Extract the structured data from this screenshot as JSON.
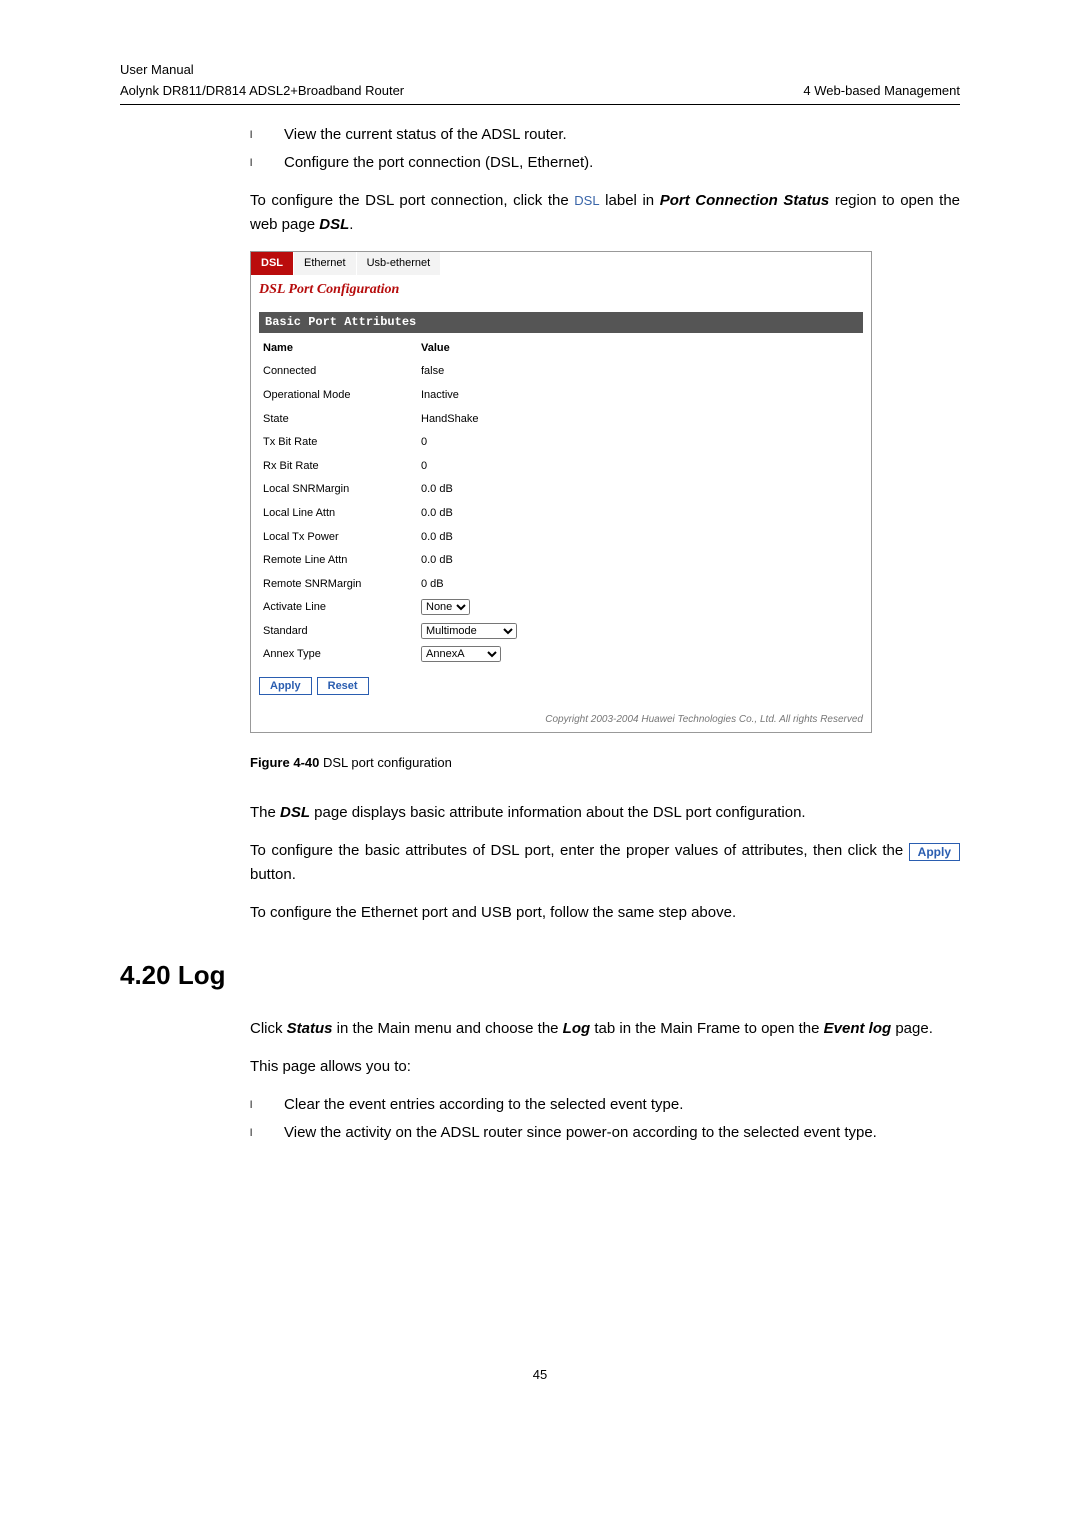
{
  "header": {
    "line1": "User Manual",
    "line2": "Aolynk DR811/DR814 ADSL2+Broadband Router",
    "right": "4  Web-based Management"
  },
  "bullets_top": [
    "View the current status of the ADSL router.",
    "Configure the port connection (DSL, Ethernet)."
  ],
  "para1_pre": "To configure the DSL port connection, click the ",
  "para1_link": "DSL",
  "para1_mid": " label in ",
  "para1_bold": "Port Connection Status",
  "para1_post": " region to open the web page ",
  "para1_bold2": "DSL",
  "para1_end": ".",
  "embed": {
    "tabs": {
      "active": "DSL",
      "t2": "Ethernet",
      "t3": "Usb-ethernet"
    },
    "title": "DSL Port Configuration",
    "section": "Basic Port Attributes",
    "th_name": "Name",
    "th_value": "Value",
    "rows": [
      {
        "n": "Connected",
        "v": "false"
      },
      {
        "n": "Operational Mode",
        "v": "Inactive"
      },
      {
        "n": "State",
        "v": "HandShake"
      },
      {
        "n": "Tx Bit Rate",
        "v": "0"
      },
      {
        "n": "Rx Bit Rate",
        "v": "0"
      },
      {
        "n": "Local SNRMargin",
        "v": "0.0 dB"
      },
      {
        "n": "Local Line Attn",
        "v": "0.0 dB"
      },
      {
        "n": "Local Tx Power",
        "v": "0.0 dB"
      },
      {
        "n": "Remote Line Attn",
        "v": "0.0 dB"
      },
      {
        "n": "Remote SNRMargin",
        "v": "0 dB"
      }
    ],
    "activate_label": "Activate Line",
    "activate_value": "None",
    "standard_label": "Standard",
    "standard_value": "Multimode",
    "annex_label": "Annex Type",
    "annex_value": "AnnexA",
    "apply": "Apply",
    "reset": "Reset",
    "copyright": "Copyright 2003-2004 Huawei Technologies Co., Ltd. All rights Reserved"
  },
  "figcap_b": "Figure 4-40 ",
  "figcap_t": "DSL port configuration",
  "para2_a": "The ",
  "para2_b": "DSL",
  "para2_c": " page displays basic attribute information about the DSL port configuration.",
  "para3_a": "To configure the basic attributes of DSL port, enter the proper values of attributes, then click the ",
  "para3_btn": "Apply",
  "para3_b": " button.",
  "para4": "To configure the Ethernet port and USB port, follow the same step above.",
  "h2": "4.20  Log",
  "para5_a": "Click ",
  "para5_b": "Status",
  "para5_c": " in the Main menu and choose the ",
  "para5_d": "Log",
  "para5_e": " tab in the Main Frame to open the ",
  "para5_f": "Event log",
  "para5_g": " page.",
  "para6": "This page allows you to:",
  "bullets_bottom": [
    "Clear the event entries according to the selected event type.",
    "View the activity on the ADSL router since power-on according to the selected event type."
  ],
  "pagenum": "45"
}
